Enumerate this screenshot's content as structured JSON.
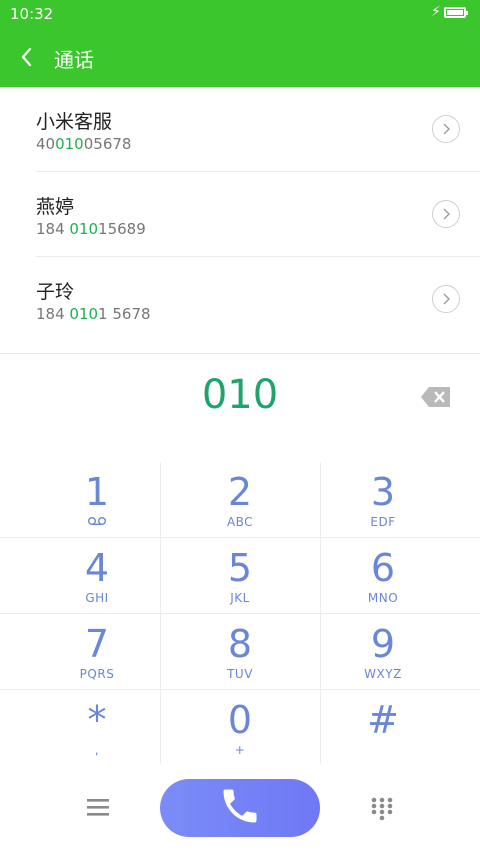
{
  "status_bar": {
    "time": "10:32",
    "charging_icon": "bolt-icon",
    "battery_icon": "battery-icon"
  },
  "app_bar": {
    "title": "通话",
    "back_icon": "chevron-left-icon"
  },
  "contacts": [
    {
      "name": "小米客服",
      "number_pre": "40",
      "number_match": "010",
      "number_post": "05678"
    },
    {
      "name": "燕婷",
      "number_pre": "184 ",
      "number_match": "010",
      "number_post": "15689"
    },
    {
      "name": "子玲",
      "number_pre": "184 ",
      "number_match": "010",
      "number_post": "1 5678"
    }
  ],
  "dialer": {
    "entered_number": "010",
    "keys": [
      {
        "digit": "1",
        "letters": "voicemail-icon"
      },
      {
        "digit": "2",
        "letters": "ABC"
      },
      {
        "digit": "3",
        "letters": "EDF"
      },
      {
        "digit": "4",
        "letters": "GHI"
      },
      {
        "digit": "5",
        "letters": "JKL"
      },
      {
        "digit": "6",
        "letters": "MNO"
      },
      {
        "digit": "7",
        "letters": "PQRS"
      },
      {
        "digit": "8",
        "letters": "TUV"
      },
      {
        "digit": "9",
        "letters": "WXYZ"
      },
      {
        "digit": "*",
        "letters": ","
      },
      {
        "digit": "0",
        "letters": "+"
      },
      {
        "digit": "#",
        "letters": ""
      }
    ]
  },
  "colors": {
    "header_green": "#3cc62d",
    "highlight_green": "#1fb04f",
    "entry_green": "#1ea36b",
    "key_blue": "#6a86d6",
    "call_button": "#7080f6"
  }
}
